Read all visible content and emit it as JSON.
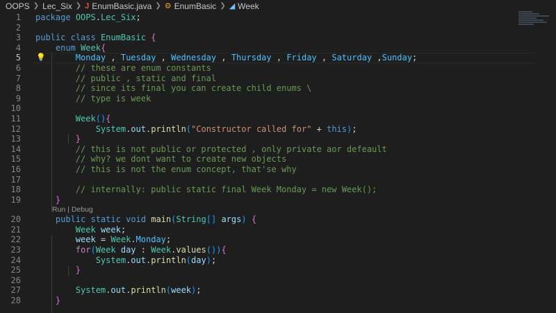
{
  "breadcrumb": {
    "items": [
      "OOPS",
      "Lec_Six",
      "EnumBasic.java",
      "EnumBasic",
      "Week"
    ]
  },
  "codelens": "Run | Debug",
  "lines": [
    {
      "n": "1",
      "t": "package OOPS.Lec_Six;"
    },
    {
      "n": "2",
      "t": ""
    },
    {
      "n": "3",
      "t": "public class EnumBasic {"
    },
    {
      "n": "4",
      "t": "    enum Week{"
    },
    {
      "n": "5",
      "t": "        Monday , Tuesday , Wednesday , Thursday , Friday , Saturday ,Sunday;"
    },
    {
      "n": "6",
      "t": "        // these are enum constants"
    },
    {
      "n": "7",
      "t": "        // public , static and final"
    },
    {
      "n": "8",
      "t": "        // since its final you can create child enums \\"
    },
    {
      "n": "9",
      "t": "        // type is week"
    },
    {
      "n": "10",
      "t": ""
    },
    {
      "n": "11",
      "t": "        Week(){"
    },
    {
      "n": "12",
      "t": "            System.out.println(\"Constructor called for\" + this);"
    },
    {
      "n": "13",
      "t": "        }"
    },
    {
      "n": "14",
      "t": "        // this is not public or protected , only private aor defeault"
    },
    {
      "n": "15",
      "t": "        // why? we dont want to create new objects"
    },
    {
      "n": "16",
      "t": "        // this is not the enum concept, that'se why"
    },
    {
      "n": "17",
      "t": ""
    },
    {
      "n": "18",
      "t": "        // internally: public static final Week Monday = new Week();"
    },
    {
      "n": "19",
      "t": "    }"
    },
    {
      "n": "20",
      "t": "    public static void main(String[] args) {"
    },
    {
      "n": "21",
      "t": "        Week week;"
    },
    {
      "n": "22",
      "t": "        week = Week.Monday;"
    },
    {
      "n": "23",
      "t": "        for(Week day : Week.values()){"
    },
    {
      "n": "24",
      "t": "            System.out.println(day);"
    },
    {
      "n": "25",
      "t": "        }"
    },
    {
      "n": "26",
      "t": ""
    },
    {
      "n": "27",
      "t": "        System.out.println(week);"
    },
    {
      "n": "28",
      "t": "    }"
    }
  ],
  "colors": {
    "background": "#1e1e1e",
    "keyword": "#569cd6",
    "control": "#c586c0",
    "type": "#4ec9b0",
    "enum_member": "#4fc1ff",
    "function": "#dcdcaa",
    "string": "#ce9178",
    "comment": "#6a9955",
    "variable": "#9cdcfe"
  },
  "icons": {
    "lightbulb": "lightbulb-icon",
    "java_file": "java-file-icon",
    "enum": "enum-icon",
    "field": "enum-member-icon"
  }
}
